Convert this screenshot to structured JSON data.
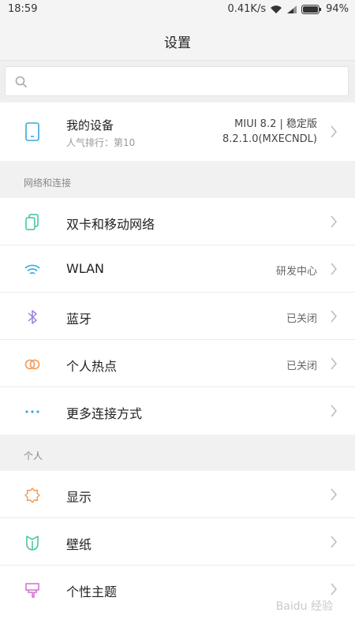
{
  "status": {
    "time": "18:59",
    "speed": "0.41K/s",
    "battery": "94%"
  },
  "header": {
    "title": "设置"
  },
  "search": {
    "placeholder": "",
    "value": ""
  },
  "device": {
    "title": "我的设备",
    "subtitle": "人气排行：第10",
    "version_line1": "MIUI 8.2 | 稳定版",
    "version_line2": "8.2.1.0(MXECNDL)"
  },
  "sections": [
    {
      "header": "网络和连接",
      "items": [
        {
          "label": "双卡和移动网络",
          "value": "",
          "icon": "sim-icon"
        },
        {
          "label": "WLAN",
          "value": "研发中心",
          "icon": "wifi-icon"
        },
        {
          "label": "蓝牙",
          "value": "已关闭",
          "icon": "bluetooth-icon"
        },
        {
          "label": "个人热点",
          "value": "已关闭",
          "icon": "hotspot-icon"
        },
        {
          "label": "更多连接方式",
          "value": "",
          "icon": "more-dots-icon"
        }
      ]
    },
    {
      "header": "个人",
      "items": [
        {
          "label": "显示",
          "value": "",
          "icon": "display-icon"
        },
        {
          "label": "壁纸",
          "value": "",
          "icon": "wallpaper-icon"
        },
        {
          "label": "个性主题",
          "value": "",
          "icon": "theme-icon"
        }
      ]
    }
  ],
  "watermark": "Baidu 经验",
  "colors": {
    "sim": "#3cc4a0",
    "wifi": "#36a8e0",
    "bluetooth": "#9b7fe0",
    "hotspot": "#f19a56",
    "more": "#36a8e0",
    "display": "#f19a56",
    "wallpaper": "#3cc4a0",
    "theme": "#d36ed0",
    "device": "#36a8e0"
  }
}
